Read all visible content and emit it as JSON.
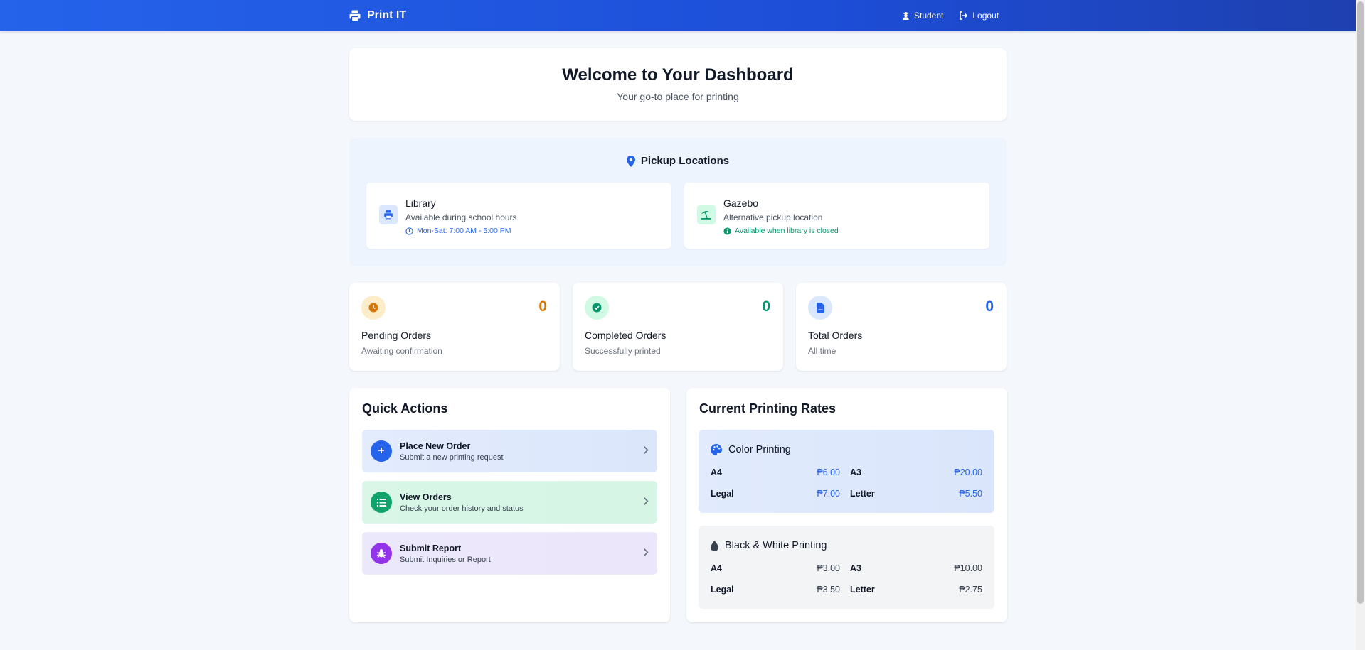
{
  "navbar": {
    "brand": "Print IT",
    "user_label": "Student",
    "logout_label": "Logout"
  },
  "welcome": {
    "title": "Welcome to Your Dashboard",
    "subtitle": "Your go-to place for printing"
  },
  "pickup": {
    "title": "Pickup Locations",
    "locations": [
      {
        "name": "Library",
        "desc": "Available during school hours",
        "note": "Mon-Sat: 7:00 AM - 5:00 PM",
        "icon": "printer-icon"
      },
      {
        "name": "Gazebo",
        "desc": "Alternative pickup location",
        "note": "Available when library is closed",
        "icon": "umbrella-beach-icon"
      }
    ]
  },
  "stats": [
    {
      "value": "0",
      "title": "Pending Orders",
      "sub": "Awaiting confirmation",
      "color": "#d97706"
    },
    {
      "value": "0",
      "title": "Completed Orders",
      "sub": "Successfully printed",
      "color": "#059669"
    },
    {
      "value": "0",
      "title": "Total Orders",
      "sub": "All time",
      "color": "#2563eb"
    }
  ],
  "quick_actions": {
    "title": "Quick Actions",
    "items": [
      {
        "title": "Place New Order",
        "sub": "Submit a new printing request"
      },
      {
        "title": "View Orders",
        "sub": "Check your order history and status"
      },
      {
        "title": "Submit Report",
        "sub": "Submit Inquiries or Report"
      }
    ]
  },
  "rates": {
    "title": "Current Printing Rates",
    "color": {
      "title": "Color Printing",
      "rows": [
        {
          "size1": "A4",
          "price1": "₱6.00",
          "size2": "A3",
          "price2": "₱20.00"
        },
        {
          "size1": "Legal",
          "price1": "₱7.00",
          "size2": "Letter",
          "price2": "₱5.50"
        }
      ]
    },
    "bw": {
      "title": "Black & White Printing",
      "rows": [
        {
          "size1": "A4",
          "price1": "₱3.00",
          "size2": "A3",
          "price2": "₱10.00"
        },
        {
          "size1": "Legal",
          "price1": "₱3.50",
          "size2": "Letter",
          "price2": "₱2.75"
        }
      ]
    }
  },
  "colors": {
    "primary": "#2563eb",
    "background": "#f4f7fb"
  }
}
